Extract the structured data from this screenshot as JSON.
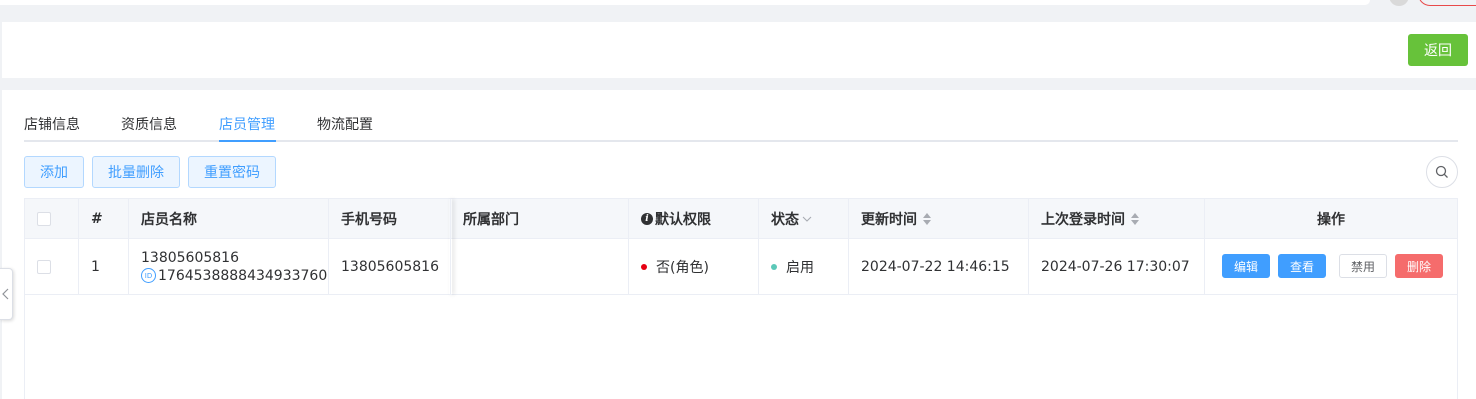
{
  "header": {
    "back_label": "返回"
  },
  "tabs": [
    {
      "label": "店铺信息"
    },
    {
      "label": "资质信息"
    },
    {
      "label": "店员管理"
    },
    {
      "label": "物流配置"
    }
  ],
  "active_tab": "店员管理",
  "toolbar": {
    "add_label": "添加",
    "batch_delete_label": "批量删除",
    "reset_password_label": "重置密码"
  },
  "table": {
    "columns": {
      "index": "#",
      "name": "店员名称",
      "phone": "手机号码",
      "department": "所属部门",
      "default_permission": "默认权限",
      "status": "状态",
      "updated_at": "更新时间",
      "last_login": "上次登录时间",
      "actions": "操作"
    },
    "rows": [
      {
        "index": "1",
        "name": "13805605816",
        "id_badge": "ID",
        "id": "1764538888434933760",
        "phone": "13805605816",
        "department": "",
        "default_permission": "否(角色)",
        "status": "启用",
        "updated_at": "2024-07-22 14:46:15",
        "last_login": "2024-07-26 17:30:07",
        "actions": {
          "edit": "编辑",
          "view": "查看",
          "disable": "禁用",
          "delete": "删除"
        }
      }
    ]
  },
  "colors": {
    "primary": "#409eff",
    "success": "#67c23a",
    "danger": "#f56c6c",
    "status_dot_enabled": "#5cc8b8",
    "permission_dot_no": "#e60012"
  },
  "icons": {
    "search": "search-icon",
    "info": "info-icon",
    "collapse": "chevron-left-icon"
  }
}
